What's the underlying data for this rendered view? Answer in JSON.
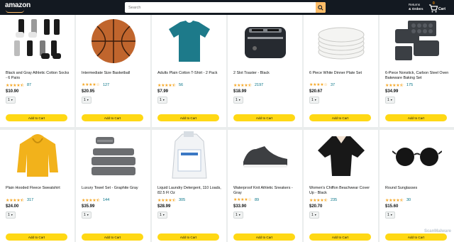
{
  "header": {
    "logo": "amazon",
    "search_placeholder": "Search",
    "returns_line1": "Returns",
    "returns_line2": "& Orders",
    "cart_count": "0",
    "cart_label": "Cart"
  },
  "products": [
    {
      "title": "Black and Gray Athletic Cotton Socks - 6 Pairs",
      "reviews": "87",
      "price": "$10.90",
      "qty": "1",
      "button": "Add to Cart",
      "image_icon": "socks-icon"
    },
    {
      "title": "Intermediate Size Basketball",
      "reviews": "127",
      "price": "$20.95",
      "qty": "1",
      "button": "Add to Cart",
      "image_icon": "basketball-icon"
    },
    {
      "title": "Adults Plain Cotton T-Shirt - 2 Pack",
      "reviews": "56",
      "price": "$7.99",
      "qty": "1",
      "button": "Add to Cart",
      "image_icon": "tshirt-icon"
    },
    {
      "title": "2 Slot Toaster - Black",
      "reviews": "2197",
      "price": "$18.99",
      "qty": "1",
      "button": "Add to Cart",
      "image_icon": "toaster-icon"
    },
    {
      "title": "6 Piece White Dinner Plate Set",
      "reviews": "37",
      "price": "$20.67",
      "qty": "1",
      "button": "Add to Cart",
      "image_icon": "plates-icon"
    },
    {
      "title": "6-Piece Nonstick, Carbon Steel Oven Bakeware Baking Set",
      "reviews": "175",
      "price": "$34.99",
      "qty": "1",
      "button": "Add to Cart",
      "image_icon": "bakeware-icon"
    },
    {
      "title": "Plain Hooded Fleece Sweatshirt",
      "reviews": "317",
      "price": "$24.00",
      "qty": "1",
      "button": "Add to Cart",
      "image_icon": "hoodie-icon"
    },
    {
      "title": "Luxury Towel Set - Graphite Gray",
      "reviews": "144",
      "price": "$35.99",
      "qty": "1",
      "button": "Add to Cart",
      "image_icon": "towels-icon"
    },
    {
      "title": "Liquid Laundry Detergent, 110 Loads, 82.5 Fl Oz",
      "reviews": "305",
      "price": "$28.99",
      "qty": "1",
      "button": "Add to Cart",
      "image_icon": "detergent-icon"
    },
    {
      "title": "Waterproof Knit Athletic Sneakers - Gray",
      "reviews": "89",
      "price": "$33.90",
      "qty": "1",
      "button": "Add to Cart",
      "image_icon": "sneaker-icon"
    },
    {
      "title": "Women's Chiffon Beachwear Cover Up - Black",
      "reviews": "235",
      "price": "$20.70",
      "qty": "1",
      "button": "Add to Cart",
      "image_icon": "coverup-icon"
    },
    {
      "title": "Round Sunglasses",
      "reviews": "30",
      "price": "$15.60",
      "qty": "1",
      "button": "Add to Cart",
      "image_icon": "sunglasses-icon"
    }
  ],
  "ratings": [
    4.5,
    4,
    4.5,
    4.5,
    4,
    4.5,
    4.5,
    4.5,
    4.5,
    4,
    4.5,
    4.5
  ],
  "colors": {
    "header": "#131921",
    "button": "#ffd814",
    "search_button": "#febd69",
    "link": "#007185",
    "star": "#f5a623"
  },
  "watermark": "ScanMalware"
}
